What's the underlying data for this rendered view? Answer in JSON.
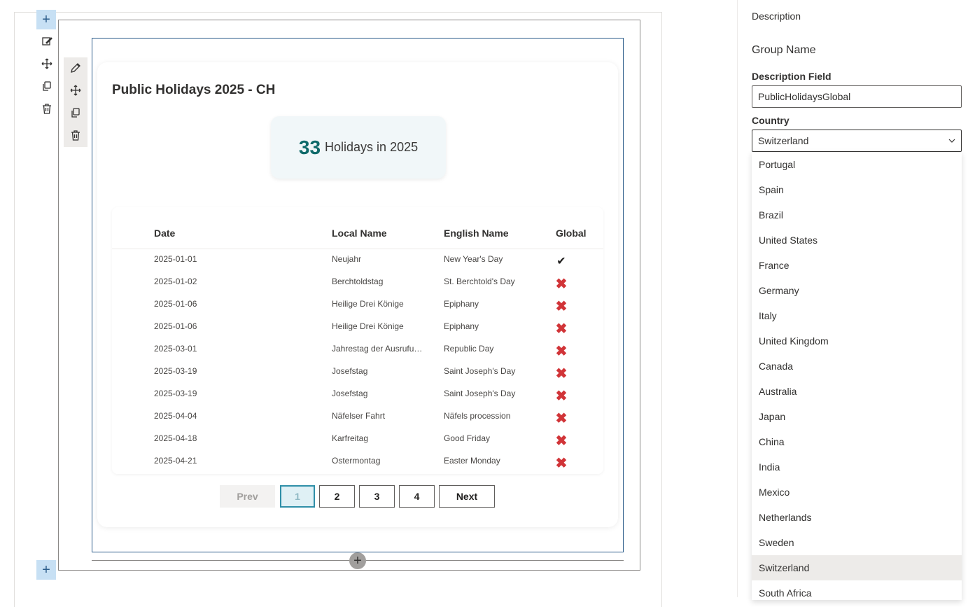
{
  "card": {
    "title": "Public Holidays 2025 - CH",
    "stat_number": "33",
    "stat_label": "Holidays in 2025"
  },
  "table": {
    "headers": [
      "Date",
      "Local Name",
      "English Name",
      "Global"
    ],
    "rows": [
      {
        "date": "2025-01-01",
        "local": "Neujahr",
        "english": "New Year's Day",
        "global": "✔"
      },
      {
        "date": "2025-01-02",
        "local": "Berchtoldstag",
        "english": "St. Berchtold's Day",
        "global": "✖"
      },
      {
        "date": "2025-01-06",
        "local": "Heilige Drei Könige",
        "english": "Epiphany",
        "global": "✖"
      },
      {
        "date": "2025-01-06",
        "local": "Heilige Drei Könige",
        "english": "Epiphany",
        "global": "✖"
      },
      {
        "date": "2025-03-01",
        "local": "Jahrestag der Ausrufung der Republik",
        "english": "Republic Day",
        "global": "✖"
      },
      {
        "date": "2025-03-19",
        "local": "Josefstag",
        "english": "Saint Joseph's Day",
        "global": "✖"
      },
      {
        "date": "2025-03-19",
        "local": "Josefstag",
        "english": "Saint Joseph's Day",
        "global": "✖"
      },
      {
        "date": "2025-04-04",
        "local": "Näfelser Fahrt",
        "english": "Näfels procession",
        "global": "✖"
      },
      {
        "date": "2025-04-18",
        "local": "Karfreitag",
        "english": "Good Friday",
        "global": "✖"
      },
      {
        "date": "2025-04-21",
        "local": "Ostermontag",
        "english": "Easter Monday",
        "global": "✖"
      }
    ]
  },
  "pagination": {
    "prev": "Prev",
    "pages": [
      "1",
      "2",
      "3",
      "4"
    ],
    "next": "Next"
  },
  "toolbar": {
    "add_symbol": "+"
  },
  "pane": {
    "description": "Description",
    "group_name": "Group Name",
    "description_field_label": "Description Field",
    "description_field_value": "PublicHolidaysGlobal",
    "country_label": "Country",
    "country_value": "Switzerland",
    "country_options": [
      "Portugal",
      "Spain",
      "Brazil",
      "United States",
      "France",
      "Germany",
      "Italy",
      "United Kingdom",
      "Canada",
      "Australia",
      "Japan",
      "China",
      "India",
      "Mexico",
      "Netherlands",
      "Sweden",
      "Switzerland",
      "South Africa"
    ]
  },
  "colors": {
    "stat_number": "#0f6a6a",
    "cross": "#d13438",
    "frame_blue": "#2b5c8a",
    "active_page_border": "#2f8fa8"
  }
}
